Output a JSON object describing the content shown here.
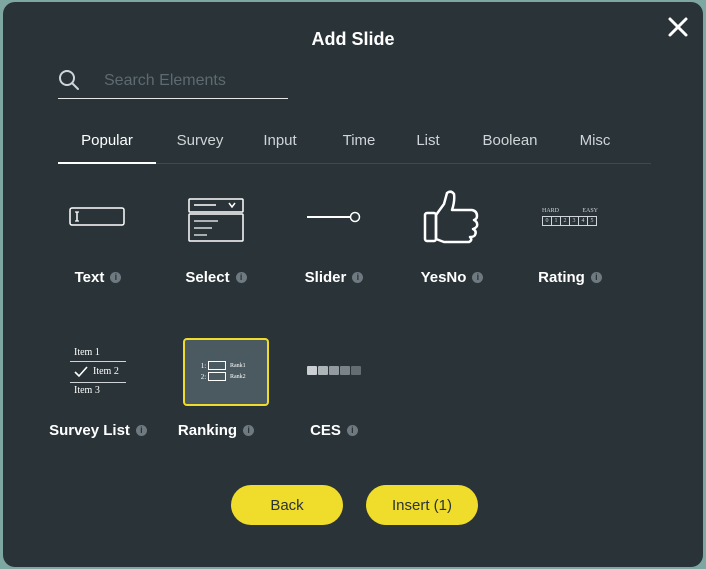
{
  "dialog": {
    "title": "Add Slide"
  },
  "search": {
    "placeholder": "Search Elements",
    "value": ""
  },
  "tabs": [
    {
      "label": "Popular",
      "active": true
    },
    {
      "label": "Survey"
    },
    {
      "label": "Input"
    },
    {
      "label": "Time"
    },
    {
      "label": "List"
    },
    {
      "label": "Boolean"
    },
    {
      "label": "Misc"
    }
  ],
  "elements": [
    {
      "label": "Text",
      "icon": "text-field-icon"
    },
    {
      "label": "Select",
      "icon": "select-dropdown-icon"
    },
    {
      "label": "Slider",
      "icon": "slider-icon"
    },
    {
      "label": "YesNo",
      "icon": "thumbs-up-icon"
    },
    {
      "label": "Rating",
      "icon": "rating-scale-icon"
    },
    {
      "label": "Survey List",
      "icon": "survey-list-icon"
    },
    {
      "label": "Ranking",
      "icon": "ranking-icon",
      "selected": true
    },
    {
      "label": "CES",
      "icon": "ces-scale-icon"
    }
  ],
  "info_glyph": "i",
  "rating_preview": {
    "low": "HARD",
    "high": "EASY",
    "scale": [
      "0",
      "1",
      "2",
      "3",
      "4",
      "5"
    ]
  },
  "survey_list_preview": {
    "items": [
      "Item 1",
      "Item 2",
      "Item 3"
    ]
  },
  "ranking_preview": {
    "rows": [
      {
        "num": "1:",
        "label": "Rank1"
      },
      {
        "num": "2:",
        "label": "Rank2"
      }
    ]
  },
  "colors": {
    "background": "#293338",
    "accent": "#f0dc2a",
    "text": "#ffffff"
  },
  "footer": {
    "back_label": "Back",
    "insert_label": "Insert (1)"
  }
}
